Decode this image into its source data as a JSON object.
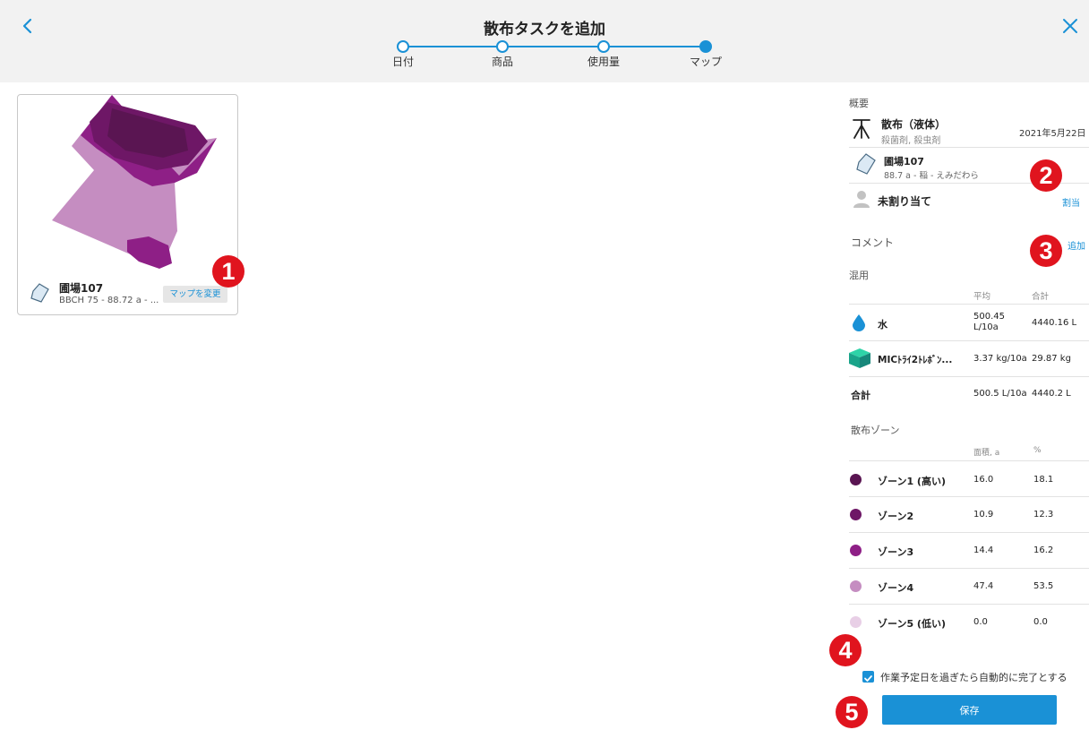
{
  "header": {
    "title": "散布タスクを追加",
    "steps": [
      {
        "label": "日付"
      },
      {
        "label": "商品"
      },
      {
        "label": "使用量"
      },
      {
        "label": "マップ"
      }
    ]
  },
  "card": {
    "field_name": "圃場107",
    "field_sub": "BBCH 75 - 88.72 a - ...",
    "change_map_label": "マップを変更"
  },
  "summary": {
    "section_title": "概要",
    "task_name": "散布（液体）",
    "task_sub": "殺菌剤, 殺虫剤",
    "date": "2021年5月22日",
    "field_name": "圃場107",
    "field_sub": "88.7 a - 稲 - えみだわら",
    "assignee": "未割り当て",
    "assign_link": "割当"
  },
  "comment": {
    "title": "コメント",
    "add_link": "追加"
  },
  "mix": {
    "title": "混用",
    "col_avg": "平均",
    "col_total": "合計",
    "rows": [
      {
        "name": "水",
        "avg": "500.45 L/10a",
        "avg_line1": "500.45",
        "avg_line2": "L/10a",
        "total": "4440.16 L"
      },
      {
        "name": "MICﾄﾗｲ2ﾄﾚﾎﾞﾝ...",
        "avg": "3.37 kg/10a",
        "total": "29.87 kg"
      }
    ],
    "total_label": "合計",
    "total_avg": "500.5 L/10a",
    "total_total": "4440.2 L"
  },
  "zones": {
    "title": "散布ゾーン",
    "col_area": "面積, a",
    "col_pct": "%",
    "rows": [
      {
        "name": "ゾーン1 (高い)",
        "area": "16.0",
        "pct": "18.1",
        "color": "#5a1552"
      },
      {
        "name": "ゾーン2",
        "area": "10.9",
        "pct": "12.3",
        "color": "#6e1766"
      },
      {
        "name": "ゾーン3",
        "area": "14.4",
        "pct": "16.2",
        "color": "#8e1f86"
      },
      {
        "name": "ゾーン4",
        "area": "47.4",
        "pct": "53.5",
        "color": "#c58dc1"
      },
      {
        "name": "ゾーン5 (低い)",
        "area": "0.0",
        "pct": "0.0",
        "color": "#e8cfe6"
      }
    ]
  },
  "auto_complete_label": "作業予定日を過ぎたら自動的に完了とする",
  "save_label": "保存",
  "annotations": [
    "1",
    "2",
    "3",
    "4",
    "5"
  ],
  "colors": {
    "accent": "#1a91d6",
    "badge": "#e0141e"
  }
}
